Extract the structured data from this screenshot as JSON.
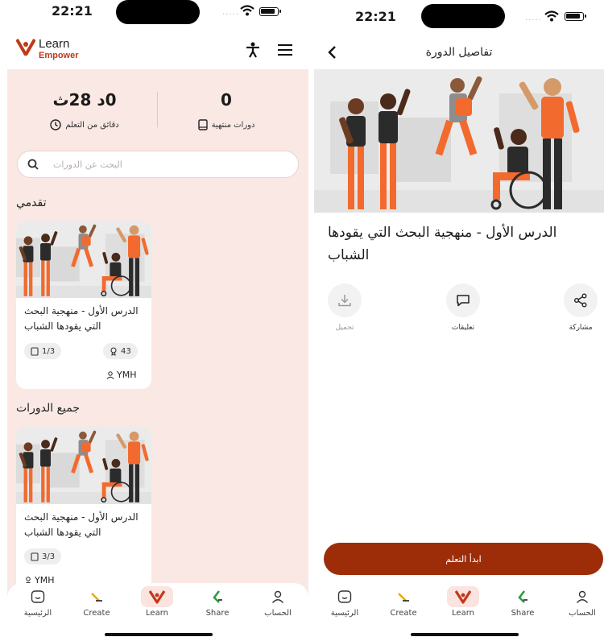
{
  "left": {
    "status": {
      "time": "22:21",
      "signal": "....."
    },
    "brand": {
      "name": "Learn",
      "sub": "Empower"
    },
    "stats": {
      "minutes_value": "0د 28ث",
      "minutes_label": "دقائق من التعلم",
      "finished_value": "0",
      "finished_label": "دورات منتهية"
    },
    "search": {
      "placeholder": "البحث عن الدورات"
    },
    "progress_section": {
      "title": "تقدمي",
      "card": {
        "title": "الدرس الأول - منهجية البحث التي يقودها الشباب",
        "lessons": "1/3",
        "likes": "43",
        "author": "YMH"
      }
    },
    "all_section": {
      "title": "جميع الدورات",
      "card": {
        "title": "الدرس الأول - منهجية البحث التي يقودها الشباب",
        "lessons": "3/3",
        "author": "YMH"
      }
    }
  },
  "nav": {
    "items": [
      {
        "label": "الرئيسية",
        "icon": "home-icon"
      },
      {
        "label": "Create",
        "icon": "create-icon"
      },
      {
        "label": "Learn",
        "icon": "learn-icon"
      },
      {
        "label": "Share",
        "icon": "share-icon"
      },
      {
        "label": "الحساب",
        "icon": "account-icon"
      }
    ],
    "active": "Learn"
  },
  "right": {
    "status": {
      "time": "22:21",
      "signal": "....."
    },
    "header_title": "تفاصيل الدورة",
    "course_title": "الدرس الأول - منهجية البحث التي يقودها الشباب",
    "actions": {
      "share": "مشاركة",
      "comments": "تعليقات",
      "download": "تحميل"
    },
    "cta": "ابدأ التعلم"
  },
  "colors": {
    "brand": "#c0391b",
    "cta": "#9c2d08",
    "tint": "#f9e8e4",
    "illustration_orange": "#f26a2e"
  }
}
